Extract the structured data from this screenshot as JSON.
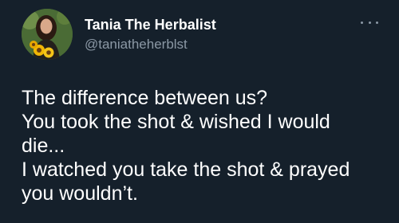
{
  "tweet": {
    "author": {
      "display_name": "Tania The Herbalist",
      "handle": "@taniatheherblst",
      "avatar_icon": "profile-photo-avatar"
    },
    "more_icon": "ellipsis-icon",
    "lines": [
      "The difference between us?",
      "You took the shot & wished I would",
      "die...",
      "I watched you take the shot & prayed",
      "you wouldn’t."
    ]
  },
  "colors": {
    "background": "#15202b",
    "primary_text": "#ffffff",
    "secondary_text": "#8b98a5"
  }
}
